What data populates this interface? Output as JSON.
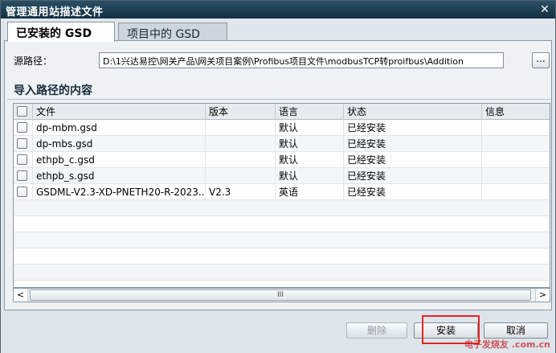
{
  "window": {
    "title": "管理通用站描述文件",
    "close_label": "✕"
  },
  "tabs": [
    {
      "label": "已安装的 GSD",
      "active": true
    },
    {
      "label": "项目中的 GSD",
      "active": false
    }
  ],
  "source": {
    "label": "源路径：",
    "value": "D:\\1兴达易控\\网关产品\\网关项目案例\\Profibus项目文件\\modbusTCP转proifbus\\Addition",
    "browse_label": "..."
  },
  "section_title": "导入路径的内容",
  "table": {
    "columns": [
      "文件",
      "版本",
      "语言",
      "状态",
      "信息"
    ],
    "rows": [
      {
        "file": "dp-mbm.gsd",
        "version": "",
        "language": "默认",
        "status": "已经安装",
        "info": ""
      },
      {
        "file": "dp-mbs.gsd",
        "version": "",
        "language": "默认",
        "status": "已经安装",
        "info": ""
      },
      {
        "file": "ethpb_c.gsd",
        "version": "",
        "language": "默认",
        "status": "已经安装",
        "info": ""
      },
      {
        "file": "ethpb_s.gsd",
        "version": "",
        "language": "默认",
        "status": "已经安装",
        "info": ""
      },
      {
        "file": "GSDML-V2.3-XD-PNETH20-R-2023...",
        "version": "V2.3",
        "language": "英语",
        "status": "已经安装",
        "info": ""
      }
    ]
  },
  "scrollbar": {
    "left_arrow": "<",
    "right_arrow": ">",
    "thumb_grip": "III"
  },
  "buttons": {
    "delete": "删除",
    "install": "安装",
    "cancel": "取消"
  },
  "watermark": "电子发烧友 .com.cn",
  "colors": {
    "titlebar": "#1c3d52",
    "highlight": "#e32621",
    "window_bg": "#dfe6ec"
  }
}
